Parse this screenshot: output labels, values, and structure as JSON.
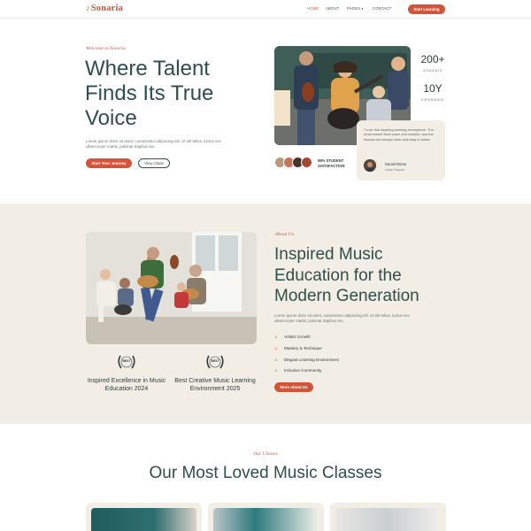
{
  "nav": {
    "logo_text": "Sonaria",
    "logo_icon": "music-note-icon",
    "items": [
      {
        "label": "HOME",
        "active": true
      },
      {
        "label": "ABOUT",
        "active": false
      },
      {
        "label": "PAGES",
        "active": false,
        "has_dropdown": true
      },
      {
        "label": "CONTACT",
        "active": false
      }
    ],
    "cta_label": "Start Learning"
  },
  "hero": {
    "eyebrow": "Welcome to Sonaria",
    "title": "Where Talent Finds Its True Voice",
    "subtitle": "Lorem ipsum dolor sit amet, consectetur adipiscing elit. Ut elit tellus, luctus nec ullamcorper mattis, pulvinar dapibus leo.",
    "primary_button": "Start Your Journey",
    "secondary_button": "View Class",
    "stats": [
      {
        "value": "200+",
        "label": "STUDENTS"
      },
      {
        "value": "10Y",
        "label": "EXPERIENCE"
      }
    ],
    "satisfaction": "98% STUDENT SATISFACTION",
    "testimonial": {
      "quote": "\"I love this inspiring learning atmosphere. The environment feels warm and creative, and the lessons are always clear and easy to follow.",
      "name": "Daniel Rome",
      "role": "Guitar Program"
    }
  },
  "about": {
    "eyebrow": "About Us",
    "title": "Inspired Music Education for the Modern Generation",
    "subtitle": "Lorem ipsum dolor sit amet, consectetur adipiscing elit. Ut elit tellus, luctus nec ullamcorper mattis, pulvinar dapibus leo.",
    "features": [
      "Artistic Growth",
      "Mastery & Technique",
      "Elegant Learning Environment",
      "Inclusive Community"
    ],
    "button": "More About Us",
    "awards": [
      {
        "badge": "BEST",
        "text": "Inspired Excellence in Music Education 2024"
      },
      {
        "badge": "BEST",
        "text": "Best Creative Music Learning Environment 2025"
      }
    ]
  },
  "classes": {
    "eyebrow": "Our Classes",
    "title": "Our Most Loved Music Classes"
  },
  "colors": {
    "accent": "#d2553a",
    "heading": "#2f4f4a",
    "cream": "#f2eee6"
  }
}
